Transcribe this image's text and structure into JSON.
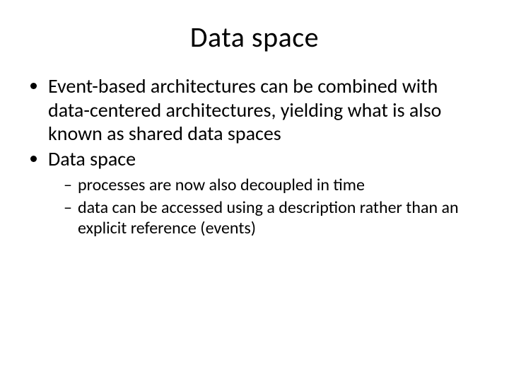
{
  "title": "Data space",
  "bullets": [
    {
      "text": "Event-based architectures can be combined with data-centered architectures, yielding what is also known as shared data spaces"
    },
    {
      "text": "Data space",
      "sub": [
        "processes are now also decoupled in time",
        "data can be accessed using a description rather than an explicit reference (events)"
      ]
    }
  ]
}
